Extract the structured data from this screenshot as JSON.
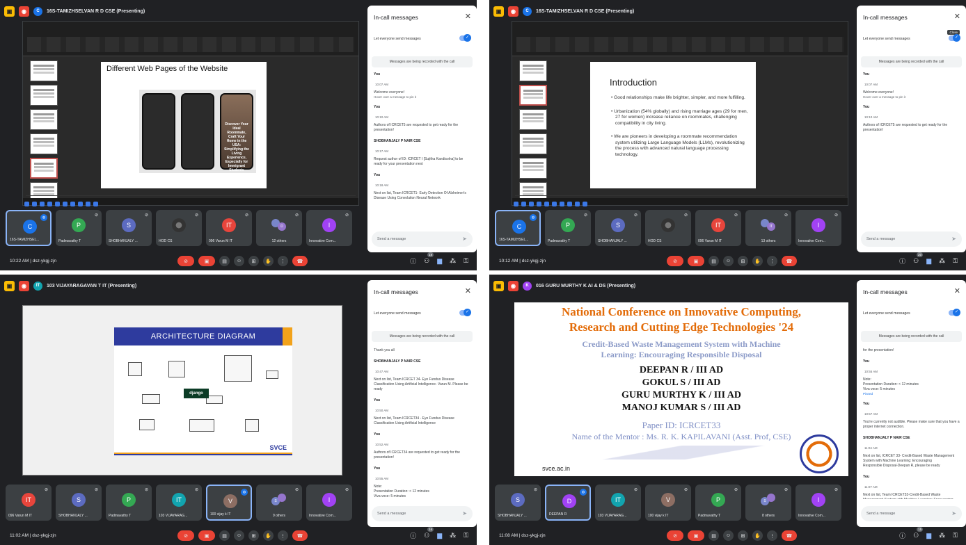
{
  "quadrants": [
    {
      "presenter": "16S-TAMIZHSELVAN R D CSE (Presenting)",
      "presenter_initial": "C",
      "presenter_color": "#1a73e8",
      "slide_title": "Different Web Pages of the Website",
      "phone_text": "Discover Your Ideal Roommate, Craft Your Home in the USA: Simplifying the Living Experience, Especially for Immigrant Students",
      "chat": {
        "title": "In-call messages",
        "everyone": "Let everyone send messages",
        "recording": "Messages are being recorded with the call",
        "messages": [
          {
            "sender": "You",
            "time": "10:07 AM",
            "text": "Welcome everyone!",
            "hint": "Hover over a message to pin it"
          },
          {
            "sender": "You",
            "time": "10:10 AM",
            "text": "Authors of ICRCET5 are requested to get ready for the presentation!"
          },
          {
            "sender": "SHOBHANJALY P NAIR CSE",
            "time": "10:17 AM",
            "text": "Request author of ID: ICRCET I [Sujitha Kandisolna] to be ready for your presentation next"
          },
          {
            "sender": "You",
            "time": "10:18 AM",
            "text": "Next on list, Team ICRCET1- Early Detection Of Alzheimer's Disease Using Convolution Neural Network"
          }
        ],
        "placeholder": "Send a message"
      },
      "tiles": [
        {
          "initial": "C",
          "name": "16S-TAMIZHSEL...",
          "color": "#1a73e8",
          "active": true
        },
        {
          "initial": "P",
          "name": "Padmavathy T",
          "color": "#34a853"
        },
        {
          "initial": "S",
          "name": "SHOBHANJALY ...",
          "color": "#5c6bc0"
        },
        {
          "initial": "",
          "name": "HOD CS",
          "color": "",
          "image": true
        },
        {
          "initial": "IT",
          "name": "096 Varun M IT",
          "color": "#e8453c"
        },
        {
          "group": true,
          "name": "12 others",
          "g1": "",
          "g2": "D"
        },
        {
          "initial": "I",
          "name": "Innovative Com...",
          "color": "#a142f4"
        }
      ],
      "time": "10:22 AM",
      "meeting_code": "dsz-ykgj-zjn",
      "people_count": "19"
    },
    {
      "presenter": "16S-TAMIZHSELVAN R D CSE (Presenting)",
      "presenter_initial": "C",
      "presenter_color": "#1a73e8",
      "slide_title": "Introduction",
      "bullets": [
        "Good relationships make life brighter, simpler, and more fulfilling.",
        "Urbanization (54% globally) and rising marriage ages (29 for men, 27 for women) increase reliance on roommates, challenging compatibility in city living.",
        "We are pioneers in developing a roommate recommendation system utilizing Large Language Models (LLMs), revolutionizing the process with advanced natural language processing technology."
      ],
      "close_tooltip": "Close",
      "chat": {
        "title": "In-call messages",
        "everyone": "Let everyone send messages",
        "recording": "Messages are being recorded with the call",
        "messages": [
          {
            "sender": "You",
            "time": "10:07 AM",
            "text": "Welcome everyone!",
            "hint": "Hover over a message to pin it"
          },
          {
            "sender": "You",
            "time": "10:10 AM",
            "text": "Authors of ICRCET5 are requested to get ready for the presentation!"
          }
        ],
        "placeholder": "Send a message"
      },
      "tiles": [
        {
          "initial": "C",
          "name": "16S-TAMIZHSEL...",
          "color": "#1a73e8",
          "active": true
        },
        {
          "initial": "P",
          "name": "Padmavathy T",
          "color": "#34a853"
        },
        {
          "initial": "S",
          "name": "SHOBHANJALY ...",
          "color": "#5c6bc0"
        },
        {
          "initial": "",
          "name": "HOD CS",
          "color": "",
          "image": true
        },
        {
          "initial": "IT",
          "name": "096 Varun M IT",
          "color": "#e8453c"
        },
        {
          "group": true,
          "name": "13 others",
          "g1": "",
          "g2": "IT"
        },
        {
          "initial": "I",
          "name": "Innovative Com...",
          "color": "#a142f4"
        }
      ],
      "time": "10:12 AM",
      "meeting_code": "dsz-ykgj-zjn",
      "people_count": "20"
    },
    {
      "presenter": "103 VIJAYARAGAVAN T IT (Presenting)",
      "presenter_initial": "IT",
      "presenter_color": "#12a4af",
      "slide_title": "ARCHITECTURE DIAGRAM",
      "django": "django",
      "svce": "SVCE",
      "chat": {
        "title": "In-call messages",
        "everyone": "Let everyone send messages",
        "recording": "Messages are being recorded with the call",
        "messages": [
          {
            "sender": "",
            "time": "",
            "text": "Thank you all"
          },
          {
            "sender": "SHOBHANJALY P NAIR CSE",
            "time": "10:47 AM",
            "text": "Next on list, Team ICRCET 34- Eye Fundus Disease Classification Using Artificial Intelligence- Varun M. Please be ready"
          },
          {
            "sender": "You",
            "time": "10:50 AM",
            "text": "Next on list, Team ICRCET34 - Eye Fundus Disease Classification Using Artificial Intelligence"
          },
          {
            "sender": "You",
            "time": "10:52 AM",
            "text": "Authors of ICRCET34 are requested to get ready for the presentation!"
          },
          {
            "sender": "You",
            "time": "10:55 AM",
            "text": "Note:\nPresentation Duration: < 12 minutes\nViva voce: 5 minutes",
            "pinned": "Pinned"
          },
          {
            "sender": "You",
            "time": "10:57 AM",
            "text": "You're currently not audible. Please make sure that you have a proper internet connection."
          }
        ],
        "placeholder": "Send a message"
      },
      "tiles": [
        {
          "initial": "IT",
          "name": "096 Varun M IT",
          "color": "#e8453c"
        },
        {
          "initial": "S",
          "name": "SHOBHANJALY ...",
          "color": "#5c6bc0"
        },
        {
          "initial": "P",
          "name": "Padmavathy T",
          "color": "#34a853"
        },
        {
          "initial": "IT",
          "name": "103 VIJAYARAG...",
          "color": "#12a4af"
        },
        {
          "initial": "V",
          "name": "100 vijay k IT",
          "color": "#8d6e63",
          "active": true
        },
        {
          "group": true,
          "name": "9 others",
          "g1": "S",
          "g2": ""
        },
        {
          "initial": "I",
          "name": "Innovative Com...",
          "color": "#a142f4"
        }
      ],
      "time": "11:02 AM",
      "meeting_code": "dsz-ykgj-zjn",
      "people_count": "16"
    },
    {
      "presenter": "016 GURU MURTHY K AI & DS (Presenting)",
      "presenter_initial": "K",
      "presenter_color": "#a142f4",
      "conf_title_1": "National Conference on Innovative Computing,",
      "conf_title_2": "Research and Cutting Edge Technologies '24",
      "paper_title_1": "Credit-Based Waste Management System with Machine",
      "paper_title_2": "Learning: Encouraging Responsible Disposal",
      "authors": [
        "DEEPAN R / III AD",
        "GOKUL S / III AD",
        "GURU MURTHY K / III AD",
        "MANOJ KUMAR S / III AD"
      ],
      "paper_id": "Paper ID: ICRCET33",
      "mentor": "Name of the Mentor : Ms. R. K. KAPILAVANI  (Asst. Prof, CSE)",
      "url": "svce.ac.in",
      "chat": {
        "title": "In-call messages",
        "everyone": "Let everyone send messages",
        "recording": "Messages are being recorded with the call",
        "messages": [
          {
            "sender": "",
            "time": "",
            "text": "for the presentation!"
          },
          {
            "sender": "You",
            "time": "10:55 AM",
            "text": "Note:\nPresentation Duration: < 12 minutes\nViva voce: 5 minutes",
            "pinned": "Pinned"
          },
          {
            "sender": "You",
            "time": "10:57 AM",
            "text": "You're currently not audible. Please make sure that you have a proper internet connection."
          },
          {
            "sender": "SHOBHANJALY P NAIR CSE",
            "time": "11:04 AM",
            "text": "Next on list, ICRCET 33- Credit-Based Waste Management System with Machine Learning: Encouraging\nResponsible Disposal-Deepan R, please be ready"
          },
          {
            "sender": "You",
            "time": "11:07 AM",
            "text": "Next on list, Team ICRCET33-Credit-Based Waste Management System with Machine Learning: Encouraging Responsible Disposal\nAuthors of ICRCET33 are requested to get ready for the presentation!"
          }
        ],
        "placeholder": "Send a message"
      },
      "tiles": [
        {
          "initial": "S",
          "name": "SHOBHANJALY ...",
          "color": "#5c6bc0"
        },
        {
          "initial": "D",
          "name": "DEEPAN R",
          "color": "#a142f4",
          "active": true
        },
        {
          "initial": "IT",
          "name": "103 VIJAYARAG...",
          "color": "#12a4af"
        },
        {
          "initial": "V",
          "name": "100 vijay k IT",
          "color": "#8d6e63"
        },
        {
          "initial": "P",
          "name": "Padmavathy T",
          "color": "#34a853"
        },
        {
          "group": true,
          "name": "8 others",
          "g1": "S",
          "g2": ""
        },
        {
          "initial": "I",
          "name": "Innovative Com...",
          "color": "#a142f4"
        }
      ],
      "time": "11:08 AM",
      "meeting_code": "dsz-ykgj-zjn",
      "people_count": "15"
    }
  ]
}
